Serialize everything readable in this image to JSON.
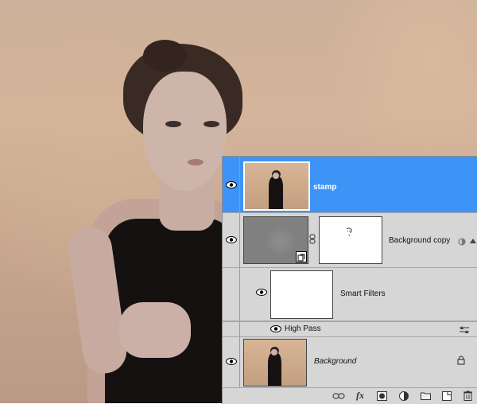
{
  "layers": [
    {
      "name": "stamp",
      "selected": true
    },
    {
      "name": "Background copy"
    },
    {
      "name": "Smart Filters"
    },
    {
      "name": "High Pass"
    },
    {
      "name": "Background"
    }
  ],
  "icons": {
    "visibility": "eye-icon",
    "link": "chain-link-icon",
    "smart_object": "smart-object-badge-icon",
    "filter_options": "filter-blending-options-icon",
    "lock": "lock-icon",
    "smart_filter_indicator": "smart-filter-icon"
  },
  "toolbar": {
    "items": [
      "link-layers",
      "fx",
      "add-mask",
      "adjustment-layer",
      "new-group",
      "new-layer",
      "delete-layer"
    ],
    "fx_label": "fx"
  },
  "colors": {
    "selection": "#3d94f6",
    "panel_bg": "#d6d6d6"
  }
}
